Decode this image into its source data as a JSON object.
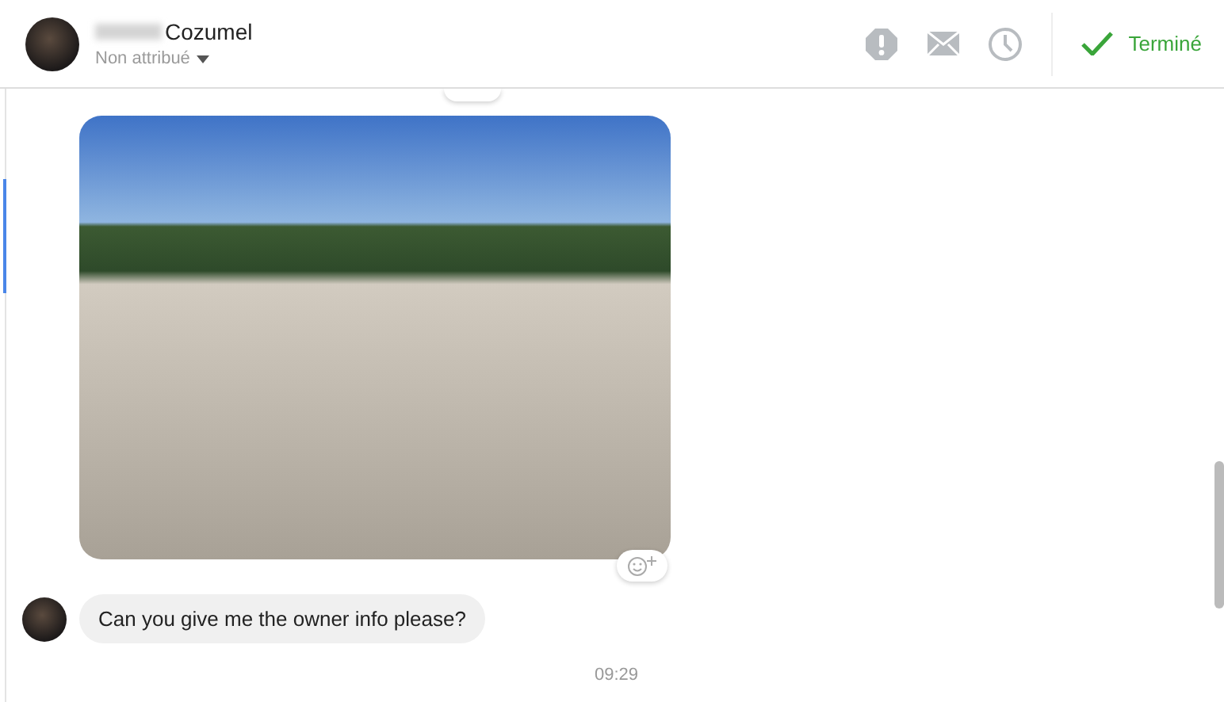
{
  "header": {
    "contact_name": "Cozumel",
    "assignment": "Non attribué",
    "actions": [
      {
        "kind": "alert"
      },
      {
        "kind": "mail"
      },
      {
        "kind": "clock"
      }
    ],
    "done_label": "Terminé"
  },
  "messages": [
    {
      "kind": "photo"
    },
    {
      "kind": "text",
      "text": "Can you give me the owner info please?"
    }
  ],
  "timestamp": "09:29"
}
